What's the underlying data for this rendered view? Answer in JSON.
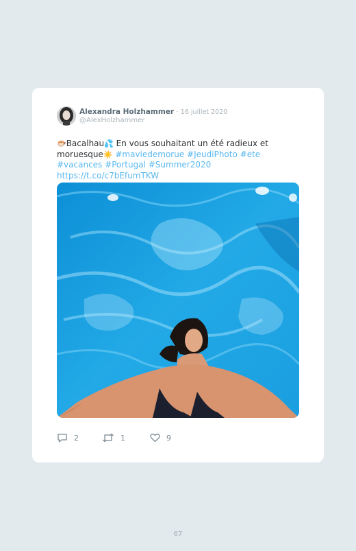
{
  "tweet": {
    "author_name": "Alexandra Holzhammer",
    "date_separator": "·",
    "date": "16 juillet 2020",
    "handle": "@AlexHolzhammer",
    "text_parts": {
      "part1": "Bacalhau",
      "part2": " En vous souhaitant un été radieux et moruesque",
      "link1": "#maviedemorue",
      "link2": "#JeudiPhoto",
      "link3": "#ete",
      "link4": "#vacances",
      "link5": "#Portugal",
      "link6": "#Summer2020",
      "link7": "https://t.co/c7bEfumTKW"
    },
    "emojis": {
      "fish": "🐡",
      "splash": "💦",
      "sun": "☀️"
    },
    "actions": {
      "reply_count": "2",
      "retweet_count": "1",
      "like_count": "9"
    }
  },
  "icons": {
    "reply": "comment-bubble-icon",
    "retweet": "retweet-arrows-icon",
    "like": "heart-icon"
  },
  "colors": {
    "page_background": "#e3eaed",
    "card_background": "#ffffff",
    "link": "#59b8f0",
    "pool_water": "#1aa3e0"
  },
  "page": {
    "number": "67"
  }
}
